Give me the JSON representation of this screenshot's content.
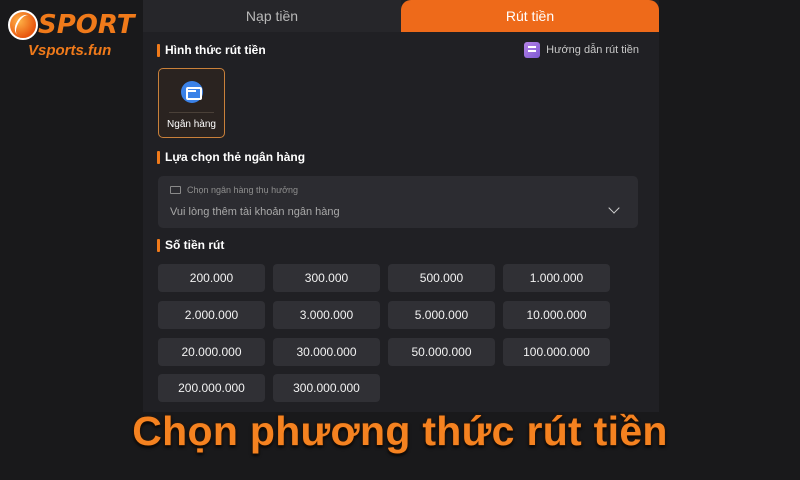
{
  "logo": {
    "brand": "SPORT",
    "site": "Vsports.fun"
  },
  "tabs": [
    {
      "label": "Nạp tiền",
      "active": false
    },
    {
      "label": "Rút tiền",
      "active": true
    }
  ],
  "method_section": {
    "title": "Hình thức rút tiền",
    "guide_label": "Hướng dẫn rút tiền",
    "methods": [
      {
        "label": "Ngân hàng",
        "icon": "bank-card-icon",
        "selected": true
      }
    ]
  },
  "bank_section": {
    "title": "Lựa chọn thẻ ngân hàng",
    "select_placeholder": "Chọn ngân hàng thụ hưởng",
    "select_hint": "Vui lòng thêm tài khoản ngân hàng"
  },
  "amount_section": {
    "title": "Số tiền rút",
    "amounts": [
      "200.000",
      "300.000",
      "500.000",
      "1.000.000",
      "2.000.000",
      "3.000.000",
      "5.000.000",
      "10.000.000",
      "20.000.000",
      "30.000.000",
      "50.000.000",
      "100.000.000",
      "200.000.000",
      "300.000.000"
    ]
  },
  "caption": "Chọn phương thức rút tiền",
  "colors": {
    "accent": "#ee6a1a",
    "background": "#19191b",
    "panel": "#202024",
    "button": "#303035"
  }
}
